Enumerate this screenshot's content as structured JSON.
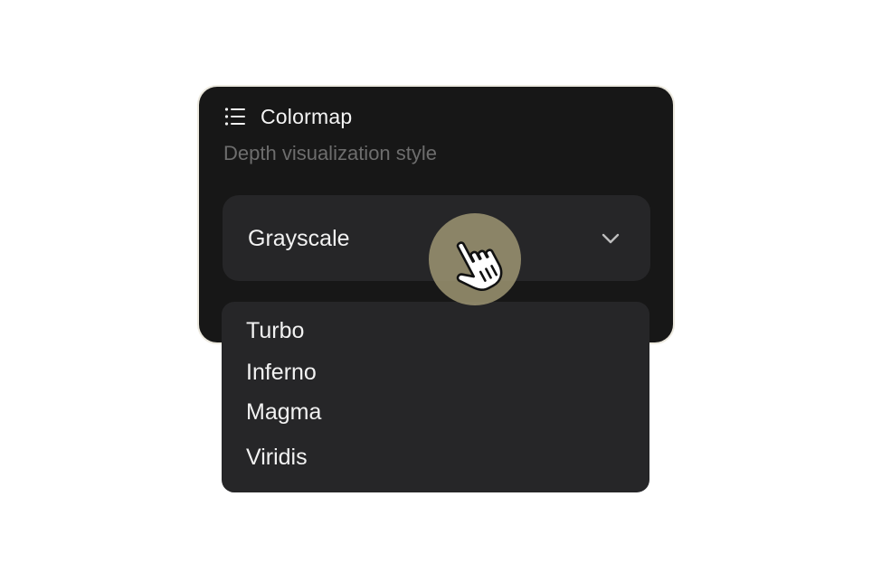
{
  "panel": {
    "title": "Colormap",
    "subtitle": "Depth visualization style",
    "icon": "list-icon"
  },
  "select": {
    "value": "Grayscale",
    "icon": "chevron-down-icon"
  },
  "dropdown": {
    "options": [
      {
        "label": "Turbo"
      },
      {
        "label": "Inferno"
      },
      {
        "label": "Magma"
      },
      {
        "label": "Viridis"
      }
    ]
  },
  "cursor": {
    "icon": "hand-pointer-icon"
  },
  "colors": {
    "panel_bg": "#171717",
    "control_bg": "#262628",
    "text": "#f2f2f2",
    "muted_text": "#6d6d6d",
    "cursor_halo": "#9a9270"
  }
}
